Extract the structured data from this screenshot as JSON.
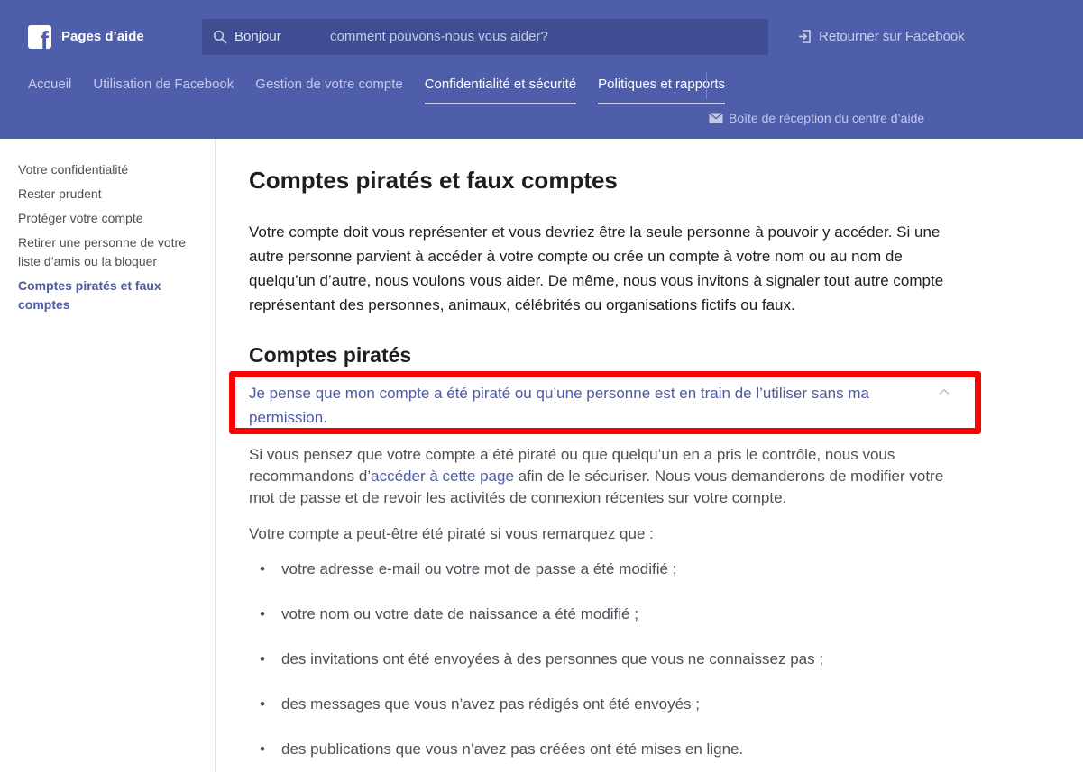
{
  "header": {
    "brand": "Pages d’aide",
    "search": {
      "prefix": "Bonjour",
      "placeholder": "comment pouvons-nous vous aider?"
    },
    "back_link": "Retourner sur Facebook",
    "inbox_link": "Boîte de réception du centre d’aide",
    "tabs": [
      {
        "label": "Accueil",
        "active": false
      },
      {
        "label": "Utilisation de Facebook",
        "active": false
      },
      {
        "label": "Gestion de votre compte",
        "active": false
      },
      {
        "label": "Confidentialité et sécurité",
        "active": true
      },
      {
        "label": "Politiques et rapports",
        "active": true
      }
    ]
  },
  "sidebar": {
    "items": [
      {
        "label": "Votre confidentialité"
      },
      {
        "label": "Rester prudent"
      },
      {
        "label": "Protéger votre compte"
      },
      {
        "label": "Retirer une personne de votre liste d’amis ou la bloquer"
      },
      {
        "label": "Comptes piratés et faux comptes",
        "active": true
      }
    ]
  },
  "main": {
    "title": "Comptes piratés et faux comptes",
    "intro": "Votre compte doit vous représenter et vous devriez être la seule personne à pouvoir y accéder. Si une autre personne parvient à accéder à votre compte ou crée un compte à votre nom ou au nom de quelqu’un d’autre, nous voulons vous aider. De même, nous vous invitons à signaler tout autre compte représentant des personnes, animaux, célébrités ou organisations fictifs ou faux.",
    "section_title": "Comptes piratés",
    "question": "Je pense que mon compte a été piraté ou qu’une personne est en train de l’utiliser sans ma permission.",
    "answer": {
      "part1": "Si vous pensez que votre compte a été piraté ou que quelqu’un en a pris le contrôle, nous vous recommandons d’",
      "link": "accéder à cette page",
      "part2": " afin de le sécuriser. Nous vous demanderons de modifier votre mot de passe et de revoir les activités de connexion récentes sur votre compte."
    },
    "list_intro": "Votre compte a peut-être été piraté si vous remarquez que :",
    "bullets": [
      "votre adresse e-mail ou votre mot de passe a été modifié ;",
      "votre nom ou votre date de naissance a été modifié ;",
      "des invitations ont été envoyées à des personnes que vous ne connaissez pas ;",
      "des messages que vous n’avez pas rédigés ont été envoyés ;",
      "des publications que vous n’avez pas créées ont été mises en ligne."
    ],
    "bullet_symbol": "•"
  },
  "colors": {
    "header_bg": "#4f5eab",
    "link": "#4b5aa4",
    "highlight": "#ff0000"
  }
}
